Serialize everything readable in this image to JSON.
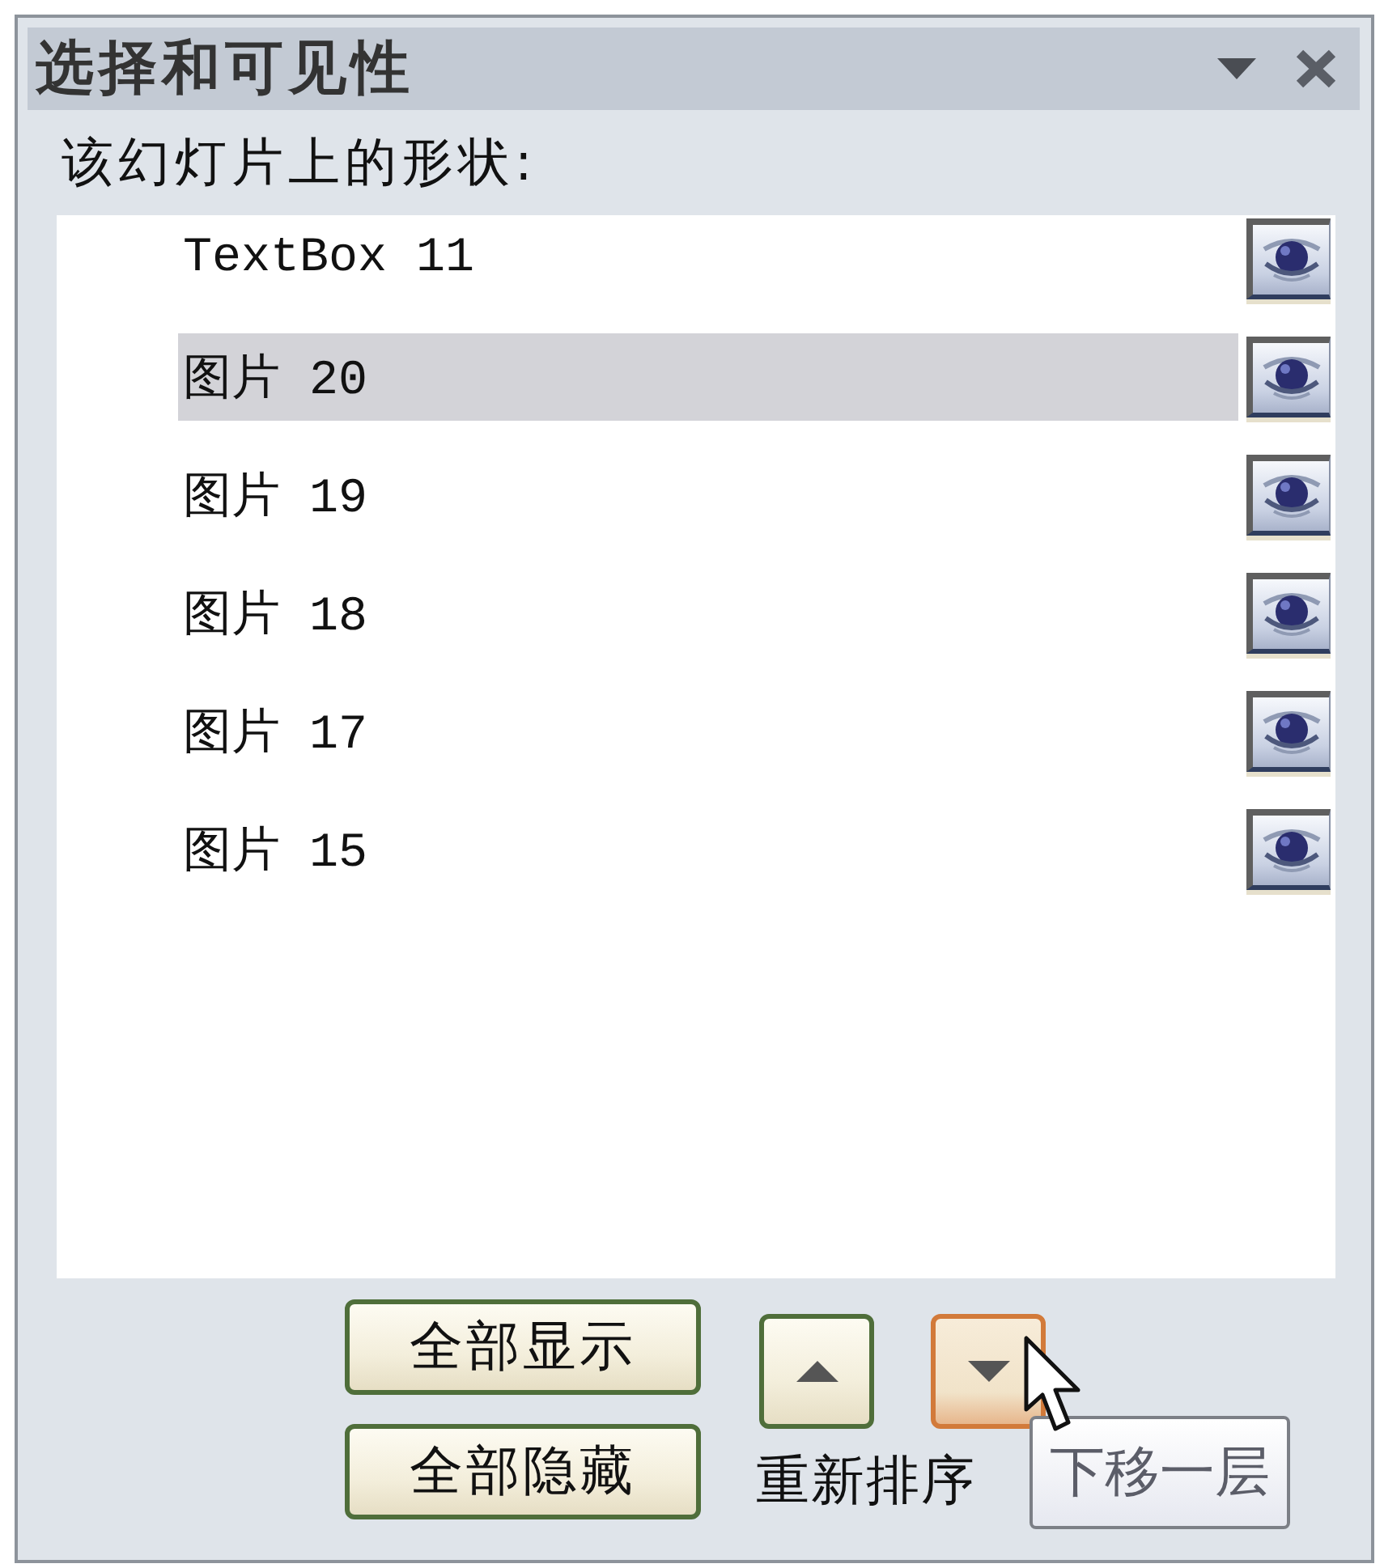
{
  "panel": {
    "title": "选择和可见性"
  },
  "shapes_label": "该幻灯片上的形状:",
  "shapes": [
    {
      "name": "TextBox 11",
      "selected": false,
      "visible": true
    },
    {
      "name": "图片 20",
      "selected": true,
      "visible": true
    },
    {
      "name": "图片 19",
      "selected": false,
      "visible": true
    },
    {
      "name": "图片 18",
      "selected": false,
      "visible": true
    },
    {
      "name": "图片 17",
      "selected": false,
      "visible": true
    },
    {
      "name": "图片 15",
      "selected": false,
      "visible": true
    }
  ],
  "buttons": [
    "全部显示",
    "全部隐藏"
  ],
  "reorder": {
    "label": "重新排序",
    "up": {
      "hovered": false
    },
    "down": {
      "hovered": true
    }
  },
  "tooltip": "下移一层"
}
